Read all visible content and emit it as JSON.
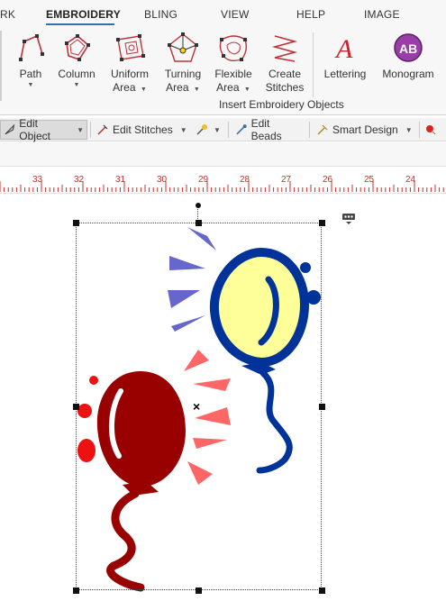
{
  "tabs": {
    "items": [
      "RK",
      "EMBROIDERY",
      "BLING",
      "VIEW",
      "HELP",
      "IMAGE"
    ],
    "active": "EMBROIDERY"
  },
  "ribbon": {
    "buttons": {
      "path": {
        "line1": "Path",
        "line2": ""
      },
      "column": {
        "line1": "Column",
        "line2": ""
      },
      "uniform_area": {
        "line1": "Uniform",
        "line2": "Area"
      },
      "turning_area": {
        "line1": "Turning",
        "line2": "Area"
      },
      "flexible_area": {
        "line1": "Flexible",
        "line2": "Area"
      },
      "create_stitches": {
        "line1": "Create",
        "line2": "Stitches"
      },
      "lettering": {
        "line1": "Lettering",
        "line2": ""
      },
      "monogram": {
        "line1": "Monogram",
        "line2": ""
      }
    },
    "group_label": "Insert Embroidery Objects"
  },
  "toolbar": {
    "edit_object": "Edit Object",
    "edit_stitches": "Edit Stitches",
    "edit_beads": "Edit Beads",
    "smart_design": "Smart Design"
  },
  "ruler": {
    "labels": [
      "33",
      "32",
      "31",
      "30",
      "29",
      "28",
      "27",
      "26",
      "25",
      "24"
    ]
  },
  "colors": {
    "balloon_yellow_fill": "#ffff99",
    "balloon_blue_outline": "#003399",
    "balloon_red": "#990000",
    "spark_blue": "#6666cc",
    "spark_pink": "#ff6666",
    "dot_red": "#ee1111",
    "ribbon_accent": "#3a6ea5"
  }
}
